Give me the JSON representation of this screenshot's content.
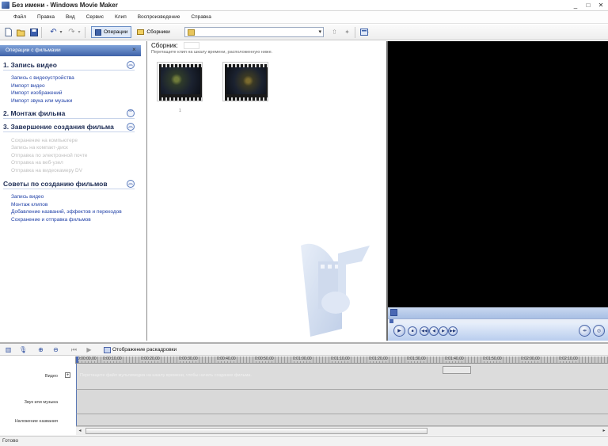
{
  "window": {
    "title": "Без имени - Windows Movie Maker"
  },
  "menu": [
    "Файл",
    "Правка",
    "Вид",
    "Сервис",
    "Клип",
    "Воспроизведение",
    "Справка"
  ],
  "toolbar": {
    "tasks_label": "Операции",
    "collections_label": "Сборники",
    "collection_select_value": ""
  },
  "taskpane": {
    "header": "Операции с фильмами",
    "sections": [
      {
        "title": "1. Запись видео",
        "links": [
          "Запись с видеоустройства",
          "Импорт видео",
          "Импорт изображений",
          "Импорт звука или музыки"
        ]
      },
      {
        "title": "2. Монтаж фильма",
        "links": []
      },
      {
        "title": "3. Завершение создания фильма",
        "links": [
          "Сохранение на компьютере",
          "Запись на компакт-диск",
          "Отправка по электронной почте",
          "Отправка на веб-узел",
          "Отправка на видеокамеру DV"
        ]
      },
      {
        "title": "Советы по созданию фильмов",
        "links": [
          "Запись видео",
          "Монтаж клипов",
          "Добавление названий, эффектов и переходов",
          "Сохранение и отправка фильмов"
        ]
      }
    ]
  },
  "collection": {
    "title": "Сборник:",
    "hint": "Перетащите клип на шкалу времени, расположенную ниже.",
    "thumb_caption": "1"
  },
  "timeline": {
    "toggle_label": "Отображение раскадровки",
    "ruler": [
      "0:00:00,00",
      "0:00:10,00",
      "0:00:20,00",
      "0:00:30,00",
      "0:00:40,00",
      "0:00:50,00",
      "0:01:00,00",
      "0:01:10,00",
      "0:01:20,00",
      "0:01:30,00",
      "0:01:40,00",
      "0:01:50,00",
      "0:02:00,00",
      "0:02:10,00"
    ],
    "tracks": [
      "Видео",
      "Звук или музыка",
      "Наложение названия"
    ],
    "video_hint": "Перетащите файл мультимедиа на шкалу времени, чтобы начать создание фильма."
  },
  "status": {
    "text": "Готово"
  },
  "icons": {
    "app": "movie-maker-icon",
    "minimize": "minimize-icon",
    "maximize": "maximize-icon",
    "close": "close-icon"
  },
  "colors": {
    "accent": "#3e62a8",
    "link": "#1e3fa6",
    "disabled": "#bfbfbf"
  }
}
